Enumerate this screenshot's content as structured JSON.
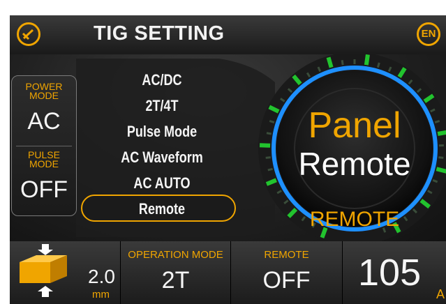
{
  "header": {
    "title": "TIG SETTING",
    "language_badge": "EN",
    "process_icon": "torch-icon"
  },
  "left_panel": {
    "power_mode_label": "POWER\nMODE",
    "power_mode_value": "AC",
    "pulse_mode_label": "PULSE\nMODE",
    "pulse_mode_value": "OFF"
  },
  "menu": {
    "items": [
      "AC/DC",
      "2T/4T",
      "Pulse Mode",
      "AC Waveform",
      "AC AUTO",
      "Remote"
    ],
    "selected": "Remote"
  },
  "dial": {
    "line1": "Panel",
    "line2": "Remote",
    "caption": "REMOTE",
    "selected_value": "Panel"
  },
  "bottom": {
    "thickness_value": "2.0",
    "thickness_unit": "mm",
    "operation_mode_label": "OPERATION MODE",
    "operation_mode_value": "2T",
    "remote_label": "REMOTE",
    "remote_value": "OFF",
    "current_value": "105",
    "current_unit": "A"
  },
  "colors": {
    "accent": "#f0a500",
    "ring": "#1e90ff",
    "tick": "#22c32e",
    "text": "#f5f5f5"
  }
}
